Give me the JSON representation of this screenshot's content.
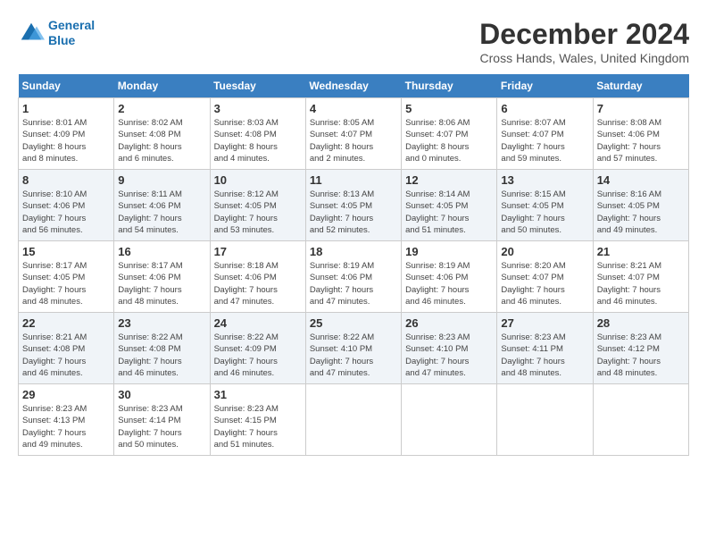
{
  "logo": {
    "line1": "General",
    "line2": "Blue"
  },
  "title": "December 2024",
  "location": "Cross Hands, Wales, United Kingdom",
  "days_of_week": [
    "Sunday",
    "Monday",
    "Tuesday",
    "Wednesday",
    "Thursday",
    "Friday",
    "Saturday"
  ],
  "weeks": [
    [
      {
        "day": "1",
        "info": "Sunrise: 8:01 AM\nSunset: 4:09 PM\nDaylight: 8 hours\nand 8 minutes."
      },
      {
        "day": "2",
        "info": "Sunrise: 8:02 AM\nSunset: 4:08 PM\nDaylight: 8 hours\nand 6 minutes."
      },
      {
        "day": "3",
        "info": "Sunrise: 8:03 AM\nSunset: 4:08 PM\nDaylight: 8 hours\nand 4 minutes."
      },
      {
        "day": "4",
        "info": "Sunrise: 8:05 AM\nSunset: 4:07 PM\nDaylight: 8 hours\nand 2 minutes."
      },
      {
        "day": "5",
        "info": "Sunrise: 8:06 AM\nSunset: 4:07 PM\nDaylight: 8 hours\nand 0 minutes."
      },
      {
        "day": "6",
        "info": "Sunrise: 8:07 AM\nSunset: 4:07 PM\nDaylight: 7 hours\nand 59 minutes."
      },
      {
        "day": "7",
        "info": "Sunrise: 8:08 AM\nSunset: 4:06 PM\nDaylight: 7 hours\nand 57 minutes."
      }
    ],
    [
      {
        "day": "8",
        "info": "Sunrise: 8:10 AM\nSunset: 4:06 PM\nDaylight: 7 hours\nand 56 minutes."
      },
      {
        "day": "9",
        "info": "Sunrise: 8:11 AM\nSunset: 4:06 PM\nDaylight: 7 hours\nand 54 minutes."
      },
      {
        "day": "10",
        "info": "Sunrise: 8:12 AM\nSunset: 4:05 PM\nDaylight: 7 hours\nand 53 minutes."
      },
      {
        "day": "11",
        "info": "Sunrise: 8:13 AM\nSunset: 4:05 PM\nDaylight: 7 hours\nand 52 minutes."
      },
      {
        "day": "12",
        "info": "Sunrise: 8:14 AM\nSunset: 4:05 PM\nDaylight: 7 hours\nand 51 minutes."
      },
      {
        "day": "13",
        "info": "Sunrise: 8:15 AM\nSunset: 4:05 PM\nDaylight: 7 hours\nand 50 minutes."
      },
      {
        "day": "14",
        "info": "Sunrise: 8:16 AM\nSunset: 4:05 PM\nDaylight: 7 hours\nand 49 minutes."
      }
    ],
    [
      {
        "day": "15",
        "info": "Sunrise: 8:17 AM\nSunset: 4:05 PM\nDaylight: 7 hours\nand 48 minutes."
      },
      {
        "day": "16",
        "info": "Sunrise: 8:17 AM\nSunset: 4:06 PM\nDaylight: 7 hours\nand 48 minutes."
      },
      {
        "day": "17",
        "info": "Sunrise: 8:18 AM\nSunset: 4:06 PM\nDaylight: 7 hours\nand 47 minutes."
      },
      {
        "day": "18",
        "info": "Sunrise: 8:19 AM\nSunset: 4:06 PM\nDaylight: 7 hours\nand 47 minutes."
      },
      {
        "day": "19",
        "info": "Sunrise: 8:19 AM\nSunset: 4:06 PM\nDaylight: 7 hours\nand 46 minutes."
      },
      {
        "day": "20",
        "info": "Sunrise: 8:20 AM\nSunset: 4:07 PM\nDaylight: 7 hours\nand 46 minutes."
      },
      {
        "day": "21",
        "info": "Sunrise: 8:21 AM\nSunset: 4:07 PM\nDaylight: 7 hours\nand 46 minutes."
      }
    ],
    [
      {
        "day": "22",
        "info": "Sunrise: 8:21 AM\nSunset: 4:08 PM\nDaylight: 7 hours\nand 46 minutes."
      },
      {
        "day": "23",
        "info": "Sunrise: 8:22 AM\nSunset: 4:08 PM\nDaylight: 7 hours\nand 46 minutes."
      },
      {
        "day": "24",
        "info": "Sunrise: 8:22 AM\nSunset: 4:09 PM\nDaylight: 7 hours\nand 46 minutes."
      },
      {
        "day": "25",
        "info": "Sunrise: 8:22 AM\nSunset: 4:10 PM\nDaylight: 7 hours\nand 47 minutes."
      },
      {
        "day": "26",
        "info": "Sunrise: 8:23 AM\nSunset: 4:10 PM\nDaylight: 7 hours\nand 47 minutes."
      },
      {
        "day": "27",
        "info": "Sunrise: 8:23 AM\nSunset: 4:11 PM\nDaylight: 7 hours\nand 48 minutes."
      },
      {
        "day": "28",
        "info": "Sunrise: 8:23 AM\nSunset: 4:12 PM\nDaylight: 7 hours\nand 48 minutes."
      }
    ],
    [
      {
        "day": "29",
        "info": "Sunrise: 8:23 AM\nSunset: 4:13 PM\nDaylight: 7 hours\nand 49 minutes."
      },
      {
        "day": "30",
        "info": "Sunrise: 8:23 AM\nSunset: 4:14 PM\nDaylight: 7 hours\nand 50 minutes."
      },
      {
        "day": "31",
        "info": "Sunrise: 8:23 AM\nSunset: 4:15 PM\nDaylight: 7 hours\nand 51 minutes."
      },
      {
        "day": "",
        "info": ""
      },
      {
        "day": "",
        "info": ""
      },
      {
        "day": "",
        "info": ""
      },
      {
        "day": "",
        "info": ""
      }
    ]
  ]
}
